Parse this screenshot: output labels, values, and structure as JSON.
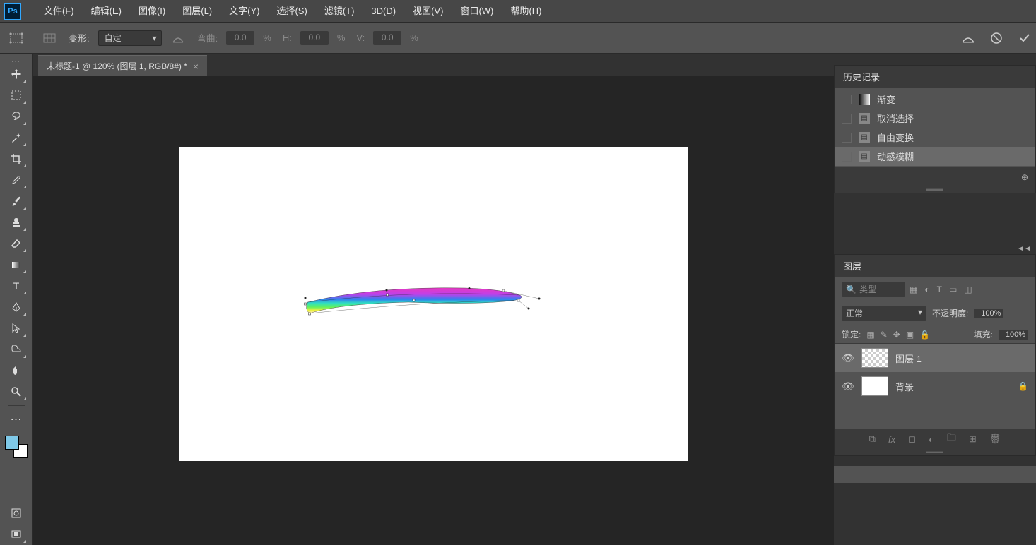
{
  "app": {
    "logo": "Ps"
  },
  "menu": [
    "文件(F)",
    "编辑(E)",
    "图像(I)",
    "图层(L)",
    "文字(Y)",
    "选择(S)",
    "滤镜(T)",
    "3D(D)",
    "视图(V)",
    "窗口(W)",
    "帮助(H)"
  ],
  "options": {
    "transform_label": "变形:",
    "transform_mode": "自定",
    "bend_label": "弯曲:",
    "bend_value": "0.0",
    "pct": "%",
    "h_label": "H:",
    "h_value": "0.0",
    "v_label": "V:",
    "v_value": "0.0"
  },
  "tab": {
    "title": "未标题-1 @ 120% (图层 1, RGB/8#) *"
  },
  "history": {
    "title": "历史记录",
    "items": [
      {
        "label": "渐变",
        "active": false
      },
      {
        "label": "取消选择",
        "active": false
      },
      {
        "label": "自由变换",
        "active": false
      },
      {
        "label": "动感模糊",
        "active": true
      }
    ]
  },
  "layers": {
    "title": "图层",
    "filter_label": "类型",
    "blend_mode": "正常",
    "opacity_label": "不透明度:",
    "opacity_value": "100%",
    "lock_label": "锁定:",
    "fill_label": "填充:",
    "fill_value": "100%",
    "items": [
      {
        "name": "图层 1",
        "selected": true,
        "checker": true,
        "locked": false
      },
      {
        "name": "背景",
        "selected": false,
        "checker": false,
        "locked": true
      }
    ]
  },
  "colors": {
    "fg": "#7FC9E8",
    "bg": "#FFFFFF"
  }
}
